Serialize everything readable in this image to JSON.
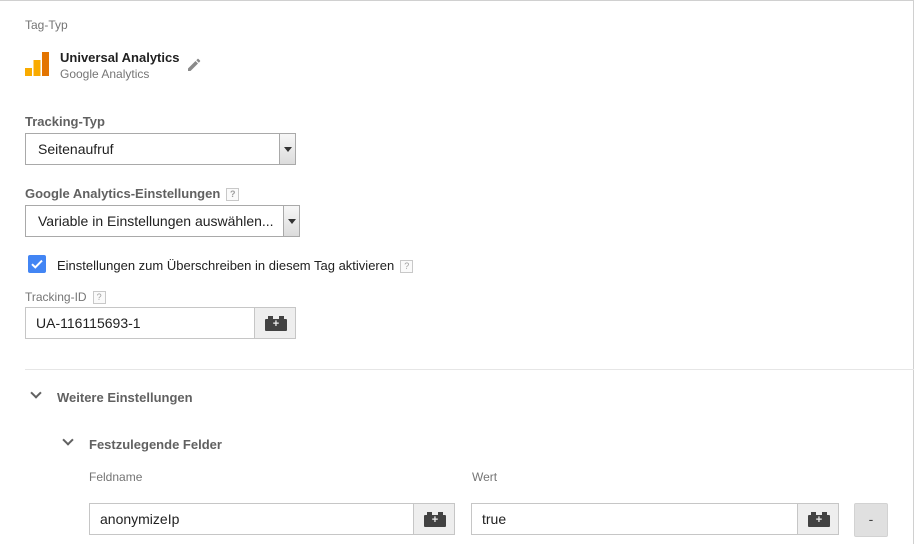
{
  "tag_type": {
    "label": "Tag-Typ",
    "name": "Universal Analytics",
    "vendor": "Google Analytics",
    "icon": "google-analytics-logo-icon",
    "edit_icon": "pencil-icon",
    "logo_colors": [
      "#f9ab00",
      "#e37400"
    ]
  },
  "tracking_type": {
    "label": "Tracking-Typ",
    "value": "Seitenaufruf"
  },
  "ga_settings": {
    "label": "Google Analytics-Einstellungen",
    "help": "?",
    "value": "Variable in Einstellungen auswählen..."
  },
  "override": {
    "checked": true,
    "label": "Einstellungen zum Überschreiben in diesem Tag aktivieren",
    "help": "?",
    "accent": "#4285f4"
  },
  "tracking_id": {
    "label": "Tracking-ID",
    "help": "?",
    "value": "UA-116115693-1",
    "var_symbol": "+"
  },
  "more_settings": {
    "label": "Weitere Einstellungen"
  },
  "fields_to_set": {
    "label": "Festzulegende Felder",
    "col_name": "Feldname",
    "col_value": "Wert",
    "rows": [
      {
        "name": "anonymizeIp",
        "value": "true",
        "remove": "-"
      }
    ]
  }
}
